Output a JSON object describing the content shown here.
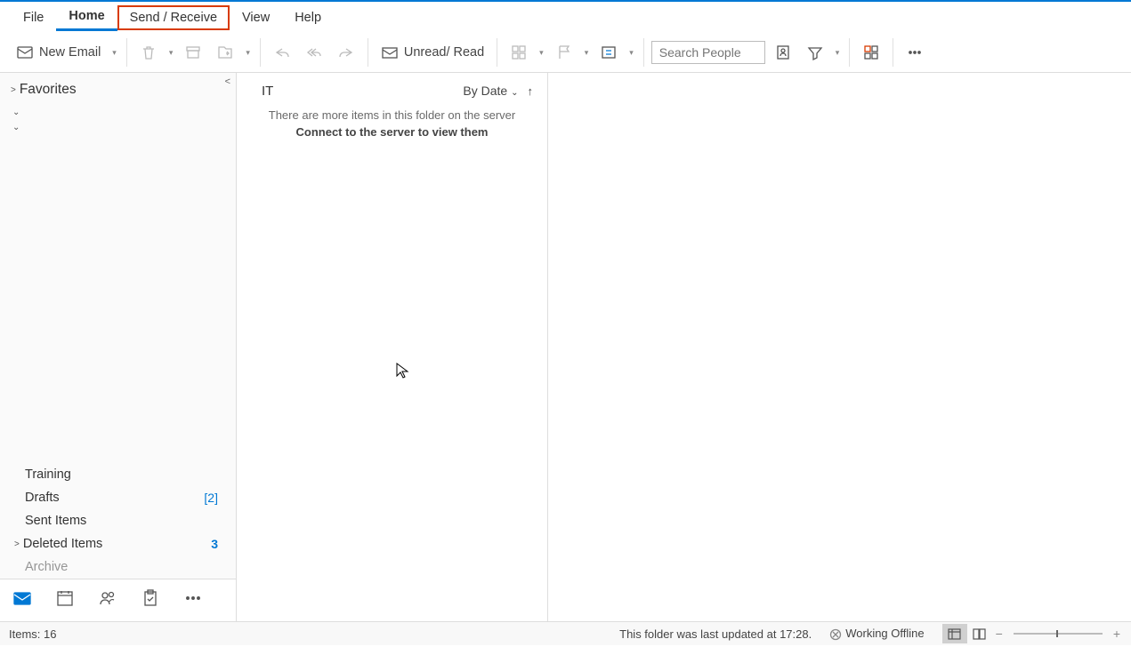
{
  "menubar": {
    "tabs": [
      "File",
      "Home",
      "Send / Receive",
      "View",
      "Help"
    ],
    "active_index": 1,
    "highlighted_index": 2
  },
  "toolbar": {
    "new_email_label": "New Email",
    "unread_read_label": "Unread/ Read",
    "search_placeholder": "Search People"
  },
  "nav": {
    "favorites_label": "Favorites",
    "folders": {
      "training": "Training",
      "drafts": "Drafts",
      "drafts_count": "[2]",
      "sent": "Sent Items",
      "deleted": "Deleted Items",
      "deleted_count": "3",
      "archive": "Archive"
    }
  },
  "message_list": {
    "folder_title": "IT",
    "sort_label": "By Date",
    "info_line1": "There are more items in this folder on the server",
    "info_line2": "Connect to the server to view them"
  },
  "status": {
    "items": "Items: 16",
    "last_updated": "This folder was last updated at 17:28.",
    "connection": "Working Offline"
  }
}
